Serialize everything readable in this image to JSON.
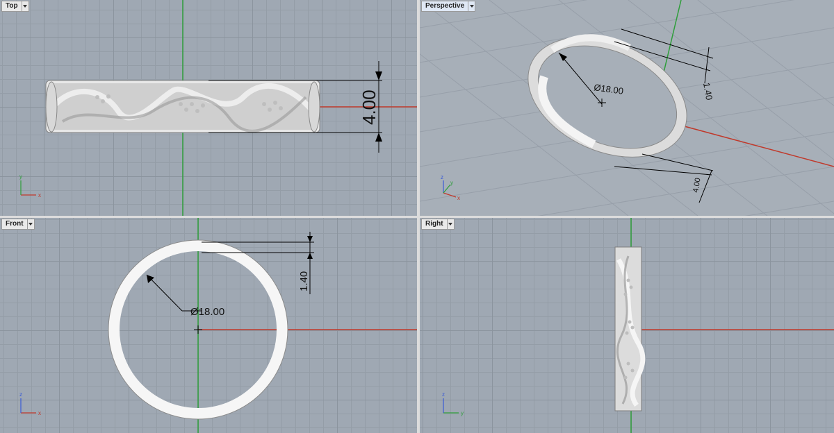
{
  "viewports": {
    "top": {
      "label": "Top"
    },
    "perspective": {
      "label": "Perspective"
    },
    "front": {
      "label": "Front"
    },
    "right": {
      "label": "Right"
    }
  },
  "dimensions": {
    "width": "4.00",
    "thickness": "1.40",
    "diameter": "Ø18.00"
  },
  "axis_labels": {
    "x": "x",
    "y": "y",
    "z": "z"
  },
  "colors": {
    "x_axis": "#c0392b",
    "y_axis": "#2e9e3a",
    "grid_bg": "#9fa8b3",
    "ring": "#f2f2f2"
  }
}
